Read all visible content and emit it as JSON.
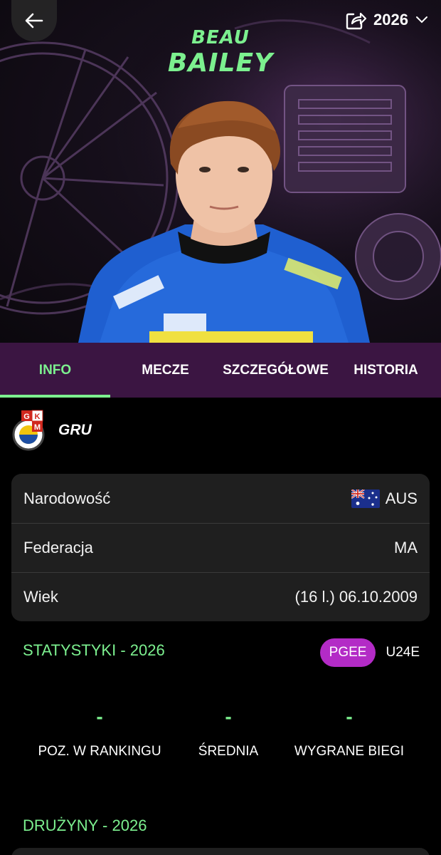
{
  "header": {
    "season": "2026",
    "icons": {
      "back": "arrow-left-icon",
      "share": "share-icon",
      "dropdown": "chevron-down-icon"
    }
  },
  "player": {
    "first_name": "BEAU",
    "last_name": "BAILEY"
  },
  "tabs": [
    {
      "label": "INFO",
      "active": true
    },
    {
      "label": "MECZE",
      "active": false
    },
    {
      "label": "SZCZEGÓŁOWE",
      "active": false
    },
    {
      "label": "HISTORIA",
      "active": false
    }
  ],
  "team": {
    "logo_letters": [
      "G",
      "K",
      "M"
    ],
    "code": "GRU"
  },
  "info": [
    {
      "label": "Narodowość",
      "value": "AUS",
      "flag": "australia-flag-icon"
    },
    {
      "label": "Federacja",
      "value": "MA"
    },
    {
      "label": "Wiek",
      "value": "(16 l.) 06.10.2009"
    }
  ],
  "stats": {
    "title": "STATYSTYKI - 2026",
    "leagues": [
      {
        "label": "PGEE",
        "active": true
      },
      {
        "label": "U24E",
        "active": false
      }
    ],
    "items": [
      {
        "value": "-",
        "label": "POZ. W RANKINGU"
      },
      {
        "value": "-",
        "label": "ŚREDNIA"
      },
      {
        "value": "-",
        "label": "WYGRANE BIEGI"
      }
    ]
  },
  "teams_section": {
    "title": "DRUŻYNY - 2026"
  },
  "colors": {
    "accent": "#7cf08f",
    "tab_bar": "#3b1542",
    "badge": "#b32bc6",
    "card": "#1f1f1f"
  }
}
